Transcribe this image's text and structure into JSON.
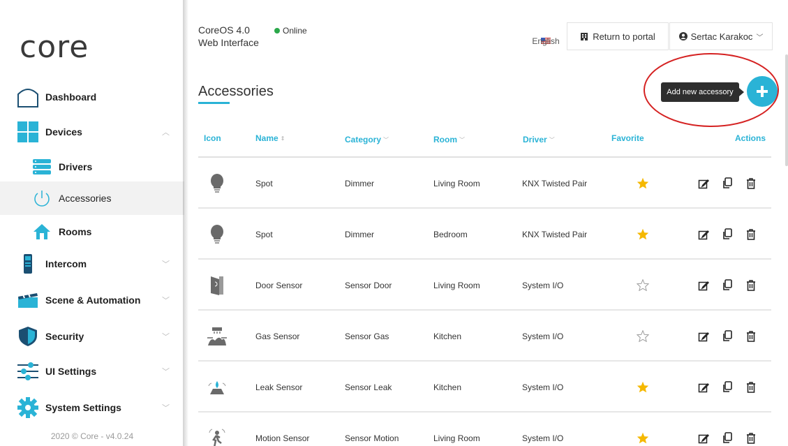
{
  "app": {
    "logo_text": "core",
    "title_line1": "CoreOS 4.0",
    "title_line2": "Web Interface",
    "status": "Online"
  },
  "header": {
    "language": "English",
    "return_portal": "Return to portal",
    "user_name": "Sertac Karakoc"
  },
  "sidebar": {
    "items": [
      {
        "label": "Dashboard",
        "icon": "dashboard-icon"
      },
      {
        "label": "Devices",
        "icon": "devices-icon"
      },
      {
        "label": "Drivers",
        "icon": "drivers-icon"
      },
      {
        "label": "Accessories",
        "icon": "accessories-icon"
      },
      {
        "label": "Rooms",
        "icon": "rooms-icon"
      },
      {
        "label": "Intercom",
        "icon": "intercom-icon"
      },
      {
        "label": "Scene & Automation",
        "icon": "scene-icon"
      },
      {
        "label": "Security",
        "icon": "security-icon"
      },
      {
        "label": "UI Settings",
        "icon": "ui-settings-icon"
      },
      {
        "label": "System Settings",
        "icon": "system-settings-icon"
      }
    ],
    "footer": "2020 © Core - v4.0.24"
  },
  "main": {
    "page_title": "Accessories",
    "add_tooltip": "Add new accessory",
    "columns": {
      "icon": "Icon",
      "name": "Name",
      "category": "Category",
      "room": "Room",
      "driver": "Driver",
      "favorite": "Favorite",
      "actions": "Actions"
    },
    "rows": [
      {
        "icon": "bulb-icon",
        "name": "Spot",
        "category": "Dimmer",
        "room": "Living Room",
        "driver": "KNX Twisted Pair",
        "favorite": true
      },
      {
        "icon": "bulb-icon",
        "name": "Spot",
        "category": "Dimmer",
        "room": "Bedroom",
        "driver": "KNX Twisted Pair",
        "favorite": true
      },
      {
        "icon": "door-sensor-icon",
        "name": "Door Sensor",
        "category": "Sensor Door",
        "room": "Living Room",
        "driver": "System I/O",
        "favorite": false
      },
      {
        "icon": "gas-sensor-icon",
        "name": "Gas Sensor",
        "category": "Sensor Gas",
        "room": "Kitchen",
        "driver": "System I/O",
        "favorite": false
      },
      {
        "icon": "leak-sensor-icon",
        "name": "Leak Sensor",
        "category": "Sensor Leak",
        "room": "Kitchen",
        "driver": "System I/O",
        "favorite": true
      },
      {
        "icon": "motion-sensor-icon",
        "name": "Motion Sensor",
        "category": "Sensor Motion",
        "room": "Living Room",
        "driver": "System I/O",
        "favorite": true
      }
    ]
  },
  "colors": {
    "accent": "#2ab3d6",
    "star_on": "#f5b800",
    "online": "#2aa84a",
    "annotation": "#d52222"
  }
}
